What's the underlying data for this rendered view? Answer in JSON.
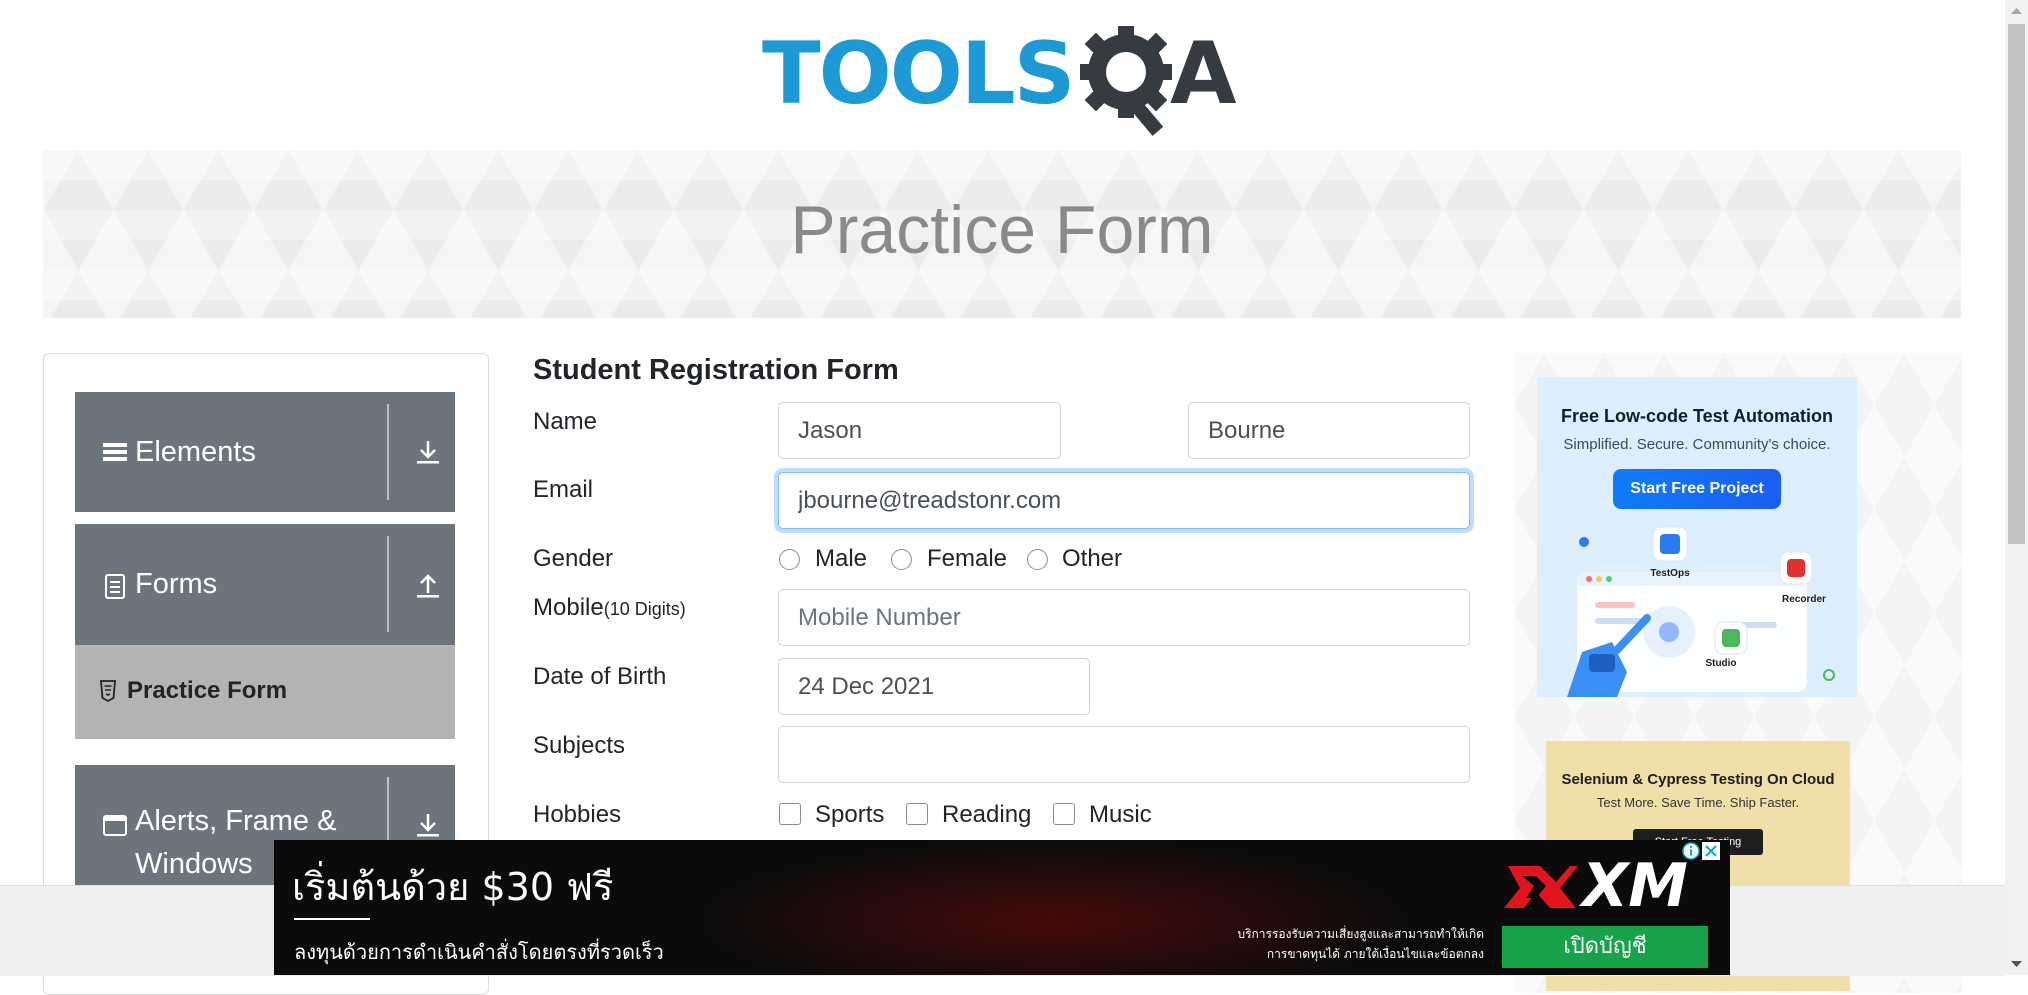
{
  "header": {
    "logo_main": "TOOLS",
    "logo_tail": "A"
  },
  "banner": {
    "title": "Practice Form"
  },
  "sidebar": {
    "groups": [
      {
        "label": "Elements",
        "icon": "hamburger-icon",
        "arrow": "download-icon"
      },
      {
        "label": "Forms",
        "icon": "document-icon",
        "arrow": "upload-icon"
      },
      {
        "label": "Alerts, Frame &",
        "label_line2": "Windows",
        "icon": "window-icon",
        "arrow": "download-icon"
      }
    ],
    "active_item": {
      "label": "Practice Form",
      "icon": "html5-icon"
    }
  },
  "form": {
    "title": "Student Registration Form",
    "name_label": "Name",
    "first_name": "Jason",
    "last_name": "Bourne",
    "email_label": "Email",
    "email": "jbourne@treadstonr.com",
    "gender_label": "Gender",
    "gender_options": [
      "Male",
      "Female",
      "Other"
    ],
    "mobile_label": "Mobile",
    "mobile_hint": "(10 Digits)",
    "mobile_placeholder": "Mobile Number",
    "dob_label": "Date of Birth",
    "dob": "24 Dec 2021",
    "subjects_label": "Subjects",
    "subjects_value": "",
    "hobbies_label": "Hobbies",
    "hobbies": [
      "Sports",
      "Reading",
      "Music"
    ]
  },
  "ads": {
    "ad1": {
      "title": "Free Low-code Test Automation",
      "subtitle": "Simplified. Secure. Community's choice.",
      "button": "Start Free Project",
      "labels": [
        "TestOps",
        "Recorder",
        "Studio"
      ]
    },
    "ad2": {
      "title": "Selenium & Cypress Testing On Cloud",
      "subtitle": "Test More. Save Time. Ship Faster.",
      "button": "Start Free Testing"
    },
    "bottom": {
      "headline": "เริ่มต้นด้วย $30 ฟรี",
      "subline": "ลงทุนด้วยการดำเนินคำสั่งโดยตรงที่รวดเร็ว",
      "brand": "XM",
      "small_text": "บริการรองรับความเสี่ยงสูงและสามารถทำให้เกิดการขาดทุนได้ ภายใต้เงื่อนไขและข้อตกลง",
      "button": "เปิดบัญชี"
    }
  },
  "colors": {
    "logo_blue": "#1d9ad6",
    "logo_dark": "#353b40",
    "sidebar_group": "#6c757d",
    "sidebar_active": "#b3b3b3",
    "focus": "#80bdff"
  }
}
